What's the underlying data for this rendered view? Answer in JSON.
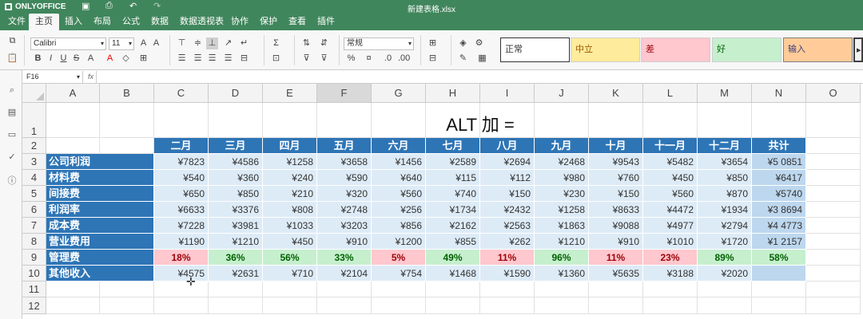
{
  "app": {
    "name": "ONLYOFFICE",
    "doc_title": "新建表格.xlsx"
  },
  "menu": [
    "文件",
    "主页",
    "插入",
    "布局",
    "公式",
    "数据",
    "数据透视表",
    "协作",
    "保护",
    "查看",
    "插件"
  ],
  "toolbar": {
    "font_name": "Calibri",
    "font_size": "11",
    "number_format": "常规",
    "styles": [
      {
        "label": "正常",
        "bg": "#ffffff",
        "color": "#000000"
      },
      {
        "label": "中立",
        "bg": "#ffeb9c",
        "color": "#9c5700"
      },
      {
        "label": "差",
        "bg": "#ffc7ce",
        "color": "#9c0006"
      },
      {
        "label": "好",
        "bg": "#c6efce",
        "color": "#006100"
      },
      {
        "label": "输入",
        "bg": "#ffcc99",
        "color": "#3f3f76"
      }
    ]
  },
  "formula_bar": {
    "name_box": "F16",
    "fx": "fx",
    "content": ""
  },
  "columns": [
    "A",
    "B",
    "C",
    "D",
    "E",
    "F",
    "G",
    "H",
    "I",
    "J",
    "K",
    "L",
    "M",
    "N",
    "O"
  ],
  "rows": [
    "1",
    "2",
    "3",
    "4",
    "5",
    "6",
    "7",
    "8",
    "9",
    "10",
    "11",
    "12"
  ],
  "sheet": {
    "title": "ALT 加 =",
    "months": [
      "二月",
      "三月",
      "四月",
      "五月",
      "六月",
      "七月",
      "八月",
      "九月",
      "十月",
      "十一月",
      "十二月",
      "共计"
    ],
    "data_rows": [
      {
        "label": "公司利润",
        "values": [
          "¥7823",
          "¥4586",
          "¥1258",
          "¥3658",
          "¥1456",
          "¥2589",
          "¥2694",
          "¥2468",
          "¥9543",
          "¥5482",
          "¥3654"
        ],
        "total": "¥5 0851"
      },
      {
        "label": "材料费",
        "values": [
          "¥540",
          "¥360",
          "¥240",
          "¥590",
          "¥640",
          "¥115",
          "¥112",
          "¥980",
          "¥760",
          "¥450",
          "¥850"
        ],
        "total": "¥6417"
      },
      {
        "label": "间接费",
        "values": [
          "¥650",
          "¥850",
          "¥210",
          "¥320",
          "¥560",
          "¥740",
          "¥150",
          "¥230",
          "¥150",
          "¥560",
          "¥870"
        ],
        "total": "¥5740"
      },
      {
        "label": "利润率",
        "values": [
          "¥6633",
          "¥3376",
          "¥808",
          "¥2748",
          "¥256",
          "¥1734",
          "¥2432",
          "¥1258",
          "¥8633",
          "¥4472",
          "¥1934"
        ],
        "total": "¥3 8694"
      },
      {
        "label": "成本费",
        "values": [
          "¥7228",
          "¥3981",
          "¥1033",
          "¥3203",
          "¥856",
          "¥2162",
          "¥2563",
          "¥1863",
          "¥9088",
          "¥4977",
          "¥2794"
        ],
        "total": "¥4 4773"
      },
      {
        "label": "营业费用",
        "values": [
          "¥1190",
          "¥1210",
          "¥450",
          "¥910",
          "¥1200",
          "¥855",
          "¥262",
          "¥1210",
          "¥910",
          "¥1010",
          "¥1720"
        ],
        "total": "¥1 2157"
      },
      {
        "label": "管理费",
        "values": [
          "18%",
          "36%",
          "56%",
          "33%",
          "5%",
          "49%",
          "11%",
          "96%",
          "11%",
          "23%",
          "89%"
        ],
        "total": "58%",
        "percent": true
      },
      {
        "label": "其他收入",
        "values": [
          "¥4575",
          "¥2631",
          "¥710",
          "¥2104",
          "¥754",
          "¥1468",
          "¥1590",
          "¥1360",
          "¥5635",
          "¥3188",
          "¥2020"
        ],
        "total": ""
      }
    ],
    "selected_column": "F"
  },
  "colors": {
    "accent": "#40865c",
    "header_blue": "#2e75b6",
    "value_bg": "#ddebf7",
    "total_bg": "#bdd7ee"
  }
}
